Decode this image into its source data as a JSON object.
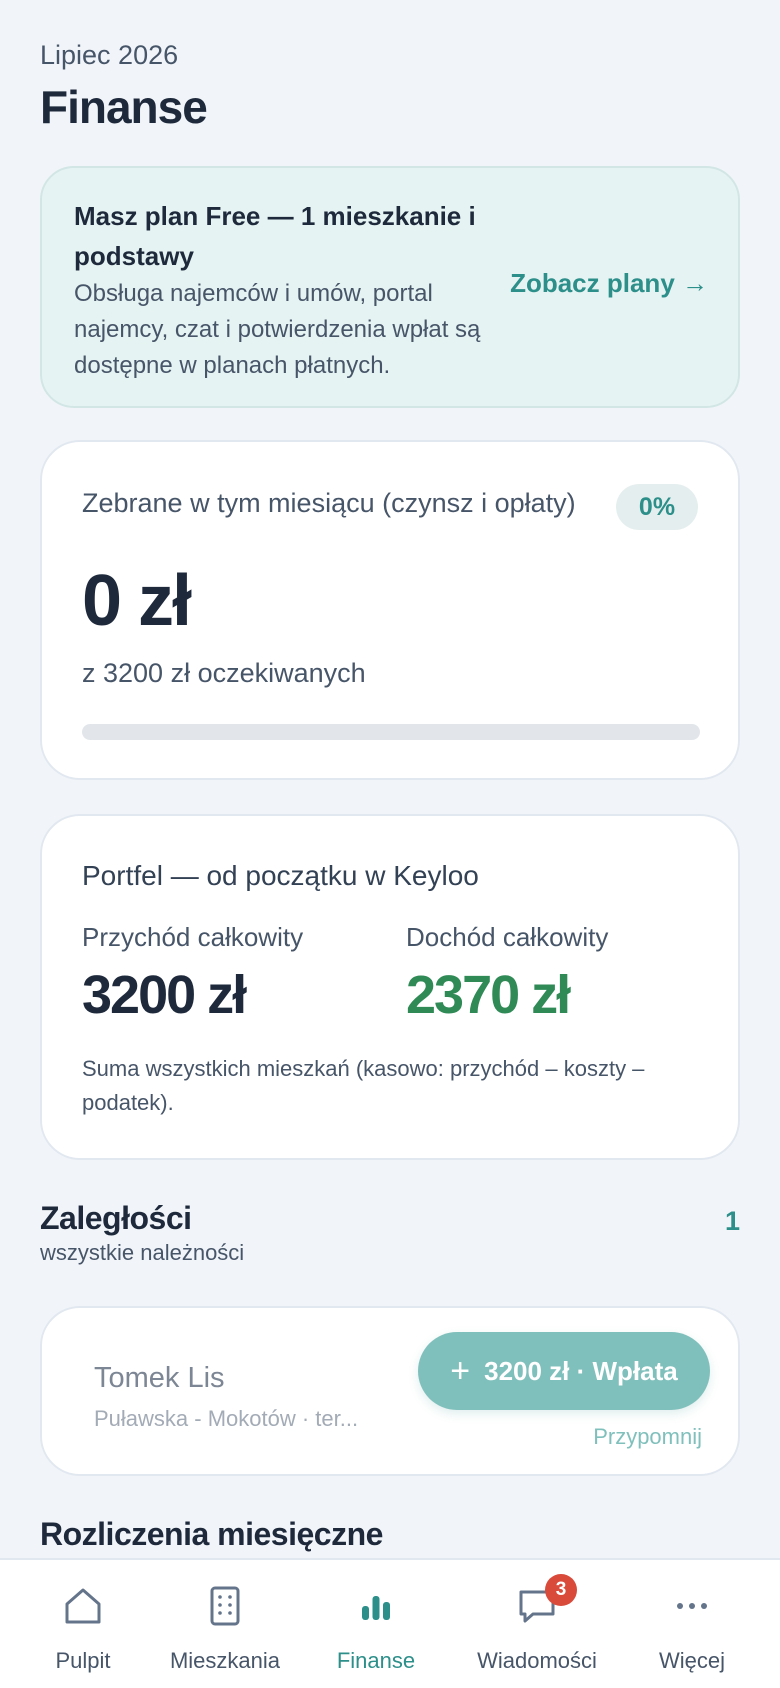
{
  "header": {
    "period": "Lipiec 2026",
    "title": "Finanse"
  },
  "plan_banner": {
    "heading": "Masz plan Free — 1 mieszkanie i podstawy",
    "description": "Obsługa najemców i umów, portal najemcy, czat i potwierdzenia wpłat są dostępne w planach płatnych.",
    "link": "Zobacz plany →"
  },
  "collected": {
    "label": "Zebrane w tym miesiącu (czynsz i opłaty)",
    "percent": "0%",
    "progress_fraction": 0,
    "amount": "0 zł",
    "expected": "z 3200 zł oczekiwanych"
  },
  "portfolio": {
    "title": "Portfel — od początku w Keyloo",
    "revenue_label": "Przychód całkowity",
    "revenue_value": "3200 zł",
    "income_label": "Dochód całkowity",
    "income_value": "2370 zł",
    "note": "Suma wszystkich mieszkań (kasowo: przychód – koszty – podatek)."
  },
  "arrears": {
    "title": "Zaległości",
    "subtitle": "wszystkie należności",
    "count": "1",
    "items": [
      {
        "tenant": "Tomek Lis",
        "address": "Puławska - Mokotów · ter...",
        "pay_label": "3200 zł · Wpłata",
        "remind_label": "Przypomnij"
      }
    ]
  },
  "monthly": {
    "title": "Rozliczenia miesięczne"
  },
  "nav": {
    "items": [
      {
        "label": "Pulpit",
        "icon": "home-icon"
      },
      {
        "label": "Mieszkania",
        "icon": "building-icon"
      },
      {
        "label": "Finanse",
        "icon": "bar-chart-icon"
      },
      {
        "label": "Wiadomości",
        "icon": "chat-icon",
        "badge": "3"
      },
      {
        "label": "Więcej",
        "icon": "more-icon"
      }
    ],
    "active": "Finanse"
  },
  "colors": {
    "accent": "#2c8f8a",
    "positive": "#2f8a56",
    "badge": "#d94a3b",
    "background": "#f1f5f9"
  }
}
